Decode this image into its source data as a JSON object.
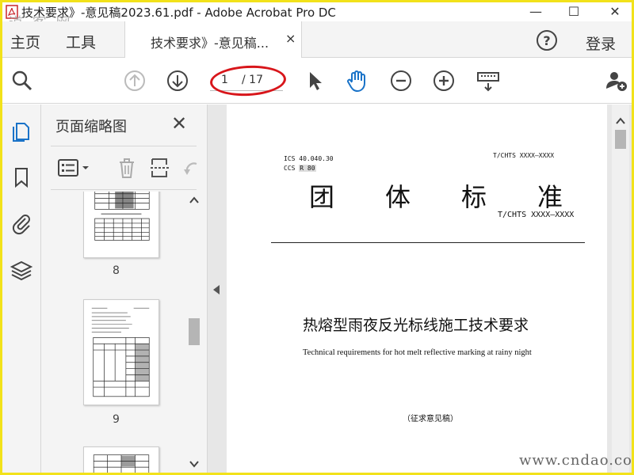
{
  "window": {
    "title": "技术要求》-意见稿2023.61.pdf - Adobe Acrobat Pro DC",
    "watermark_top": "道 客 网",
    "minimize": "—",
    "maximize": "☐",
    "close": "✕"
  },
  "tabs": {
    "home": "主页",
    "tools": "工具",
    "document": "技术要求》-意见稿...",
    "document_close": "×",
    "help": "?",
    "login": "登录"
  },
  "toolbar": {
    "current_page": "1",
    "total_pages": "/ 17",
    "icons": [
      "search-icon",
      "prev-page-icon",
      "next-page-icon",
      "select-cursor-icon",
      "hand-tool-icon",
      "zoom-out-icon",
      "zoom-in-icon",
      "keyboard-icon",
      "share-user-icon"
    ]
  },
  "left_nav": {
    "icons": [
      "page-thumbnails-icon",
      "bookmark-icon",
      "attachment-icon",
      "layers-icon"
    ]
  },
  "thumbnail_panel": {
    "title": "页面缩略图",
    "close": "✕",
    "pages": [
      {
        "label": "8"
      },
      {
        "label": "9"
      },
      {
        "label": ""
      }
    ]
  },
  "document": {
    "ics": "ICS  40.040.30",
    "ccs_label": "CCS",
    "ccs_value": "R 80",
    "code_top": "T/CHTS XXXX—XXXX",
    "heading": "团　　体　　标　　准",
    "code_main": "T/CHTS  XXXX—XXXX",
    "title_cn": "热熔型雨夜反光标线施工技术要求",
    "title_en": "Technical requirements for hot melt reflective marking at rainy night",
    "draft_note": "（征求意见稿）"
  },
  "watermark_bottom": "www.cndao.com",
  "colors": {
    "accent_blue": "#1a73c8",
    "annotation_red": "#d8161b",
    "frame_yellow": "#f2e21a"
  }
}
